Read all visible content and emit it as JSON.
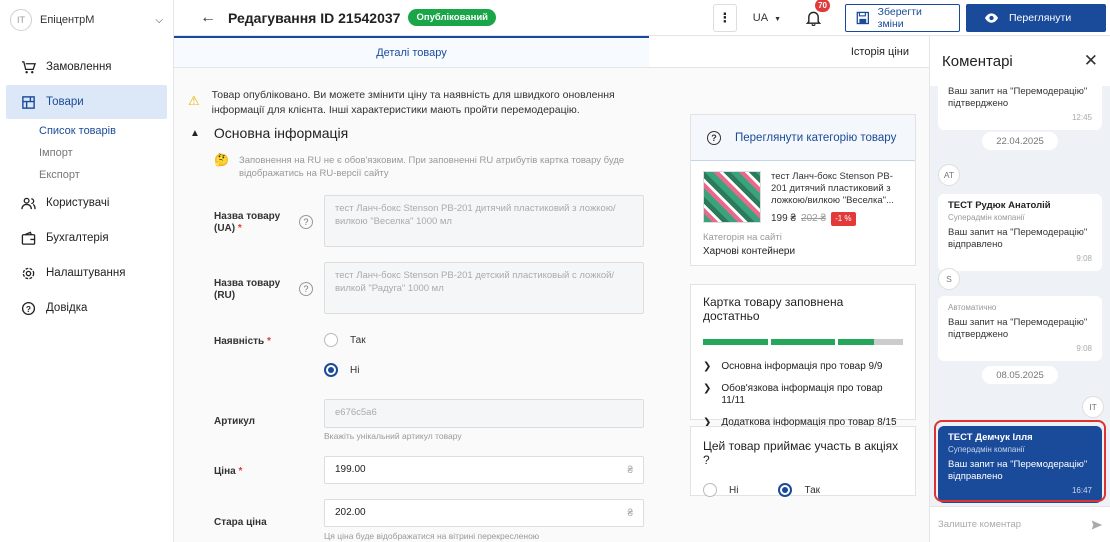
{
  "sidebar": {
    "company_avatar": "IT",
    "company_name": "ЕпіцентрМ",
    "items": [
      {
        "label": "Замовлення",
        "icon": "cart-icon"
      },
      {
        "label": "Товари",
        "icon": "box-icon"
      },
      {
        "label": "Користувачі",
        "icon": "users-icon"
      },
      {
        "label": "Бухгалтерія",
        "icon": "wallet-icon"
      },
      {
        "label": "Налаштування",
        "icon": "gear-icon"
      },
      {
        "label": "Довідка",
        "icon": "help-icon"
      }
    ],
    "sub_items": [
      "Список товарів",
      "Імпорт",
      "Експорт"
    ]
  },
  "header": {
    "title": "Редагування ID 21542037",
    "status_badge": "Опублікований",
    "lang": "UA",
    "notifications_count": "70",
    "save_label": "Зберегти зміни",
    "view_label": "Переглянути"
  },
  "tabs": [
    "Деталі товару",
    "Історія ціни"
  ],
  "main": {
    "notice": "Товар опубліковано. Ви можете змінити ціну та наявність для швидкого оновлення інформації для клієнта. Інші характеристики мають пройти перемодерацію.",
    "section_title": "Основна інформація",
    "ru_note": "Заповнення на RU не є обов'язковим. При заповненні RU атрибутів картка товару буде відображатись на RU-версії сайту",
    "name_ua_label": "Назва товару (UA)",
    "name_ua_value": "тест Ланч-бокс Stenson PB-201 дитячий пластиковий з ложкою/вилкою \"Веселка\" 1000 мл",
    "name_ru_label": "Назва товару (RU)",
    "name_ru_value": "тест Ланч-бокс Stenson PB-201 детский пластиковый с ложкой/вилкой \"Радуга\" 1000 мл",
    "availability_label": "Наявність",
    "radio_yes": "Так",
    "radio_no": "Ні",
    "sku_label": "Артикул",
    "sku_value": "e676c5a6",
    "sku_hint": "Вкажіть унікальний артикул товару",
    "price_label": "Ціна",
    "price_value": "199.00",
    "old_price_label": "Стара ціна",
    "old_price_value": "202.00",
    "old_price_hint": "Ця ціна буде відображатися на вітрині перекресленою",
    "currency": "₴",
    "required_mark": "*",
    "help_mark": "?"
  },
  "right": {
    "category_button": "Переглянути категорію товару",
    "product_title": "тест Ланч-бокс Stenson PB-201 дитячий пластиковий з ложкою/вилкою \"Веселка\"...",
    "price": "199 ₴",
    "old_price": "202 ₴",
    "discount": "-1 %",
    "category_label": "Категорія на сайті",
    "category_value": "Харчові контейнери",
    "completeness_title": "Картка товару заповнена достатньо",
    "completeness_items": [
      "Основна інформація про товар 9/9",
      "Обов'язкова інформація про товар 11/11",
      "Додаткова інформація про товар 8/15"
    ],
    "promo_title": "Цей товар приймає участь в акціях ?",
    "promo_no": "Ні",
    "promo_yes": "Так"
  },
  "comments": {
    "title": "Коментарі",
    "msg1_text": "Ваш запит на \"Перемодерацію\" підтверджено",
    "msg1_time": "12:45",
    "date1": "22.04.2025",
    "av_at": "АТ",
    "msg2_author": "ТЕСТ Рудюк Анатолій",
    "msg2_role": "Суперадмін компанії",
    "msg2_text": "Ваш запит на \"Перемодерацію\" відправлено",
    "msg2_time": "9:08",
    "av_s": "S",
    "msg3_role": "Автоматично",
    "msg3_text": "Ваш запит на \"Перемодерацію\" підтверджено",
    "msg3_time": "9:08",
    "date2": "08.05.2025",
    "av_it": "IT",
    "msg4_author": "ТЕСТ Демчук Ілля",
    "msg4_role": "Суперадмін компанії",
    "msg4_text": "Ваш запит на \"Перемодерацію\" відправлено",
    "msg4_time": "16:47",
    "input_placeholder": "Залиште коментар"
  },
  "colors": {
    "accent": "#1a4a9a",
    "success": "#1aa648",
    "danger": "#e23a3a"
  }
}
